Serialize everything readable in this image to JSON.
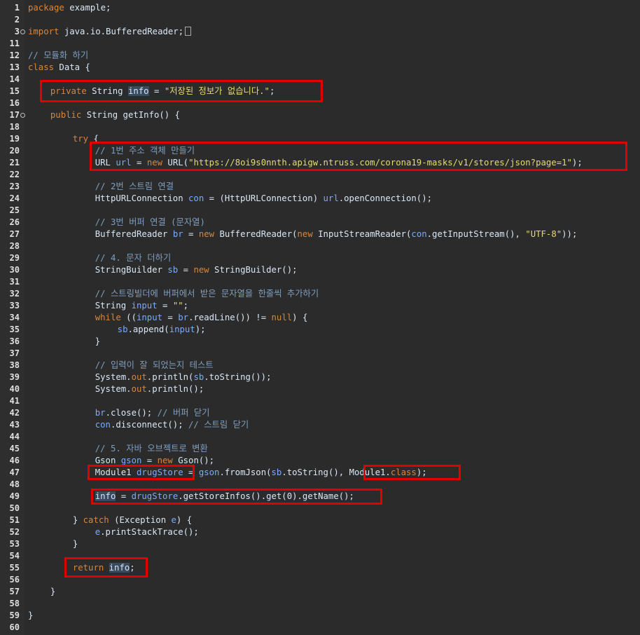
{
  "line_numbers": [
    "1",
    "2",
    "3",
    "11",
    "12",
    "13",
    "14",
    "15",
    "16",
    "17",
    "18",
    "19",
    "20",
    "21",
    "22",
    "23",
    "24",
    "25",
    "26",
    "27",
    "28",
    "29",
    "30",
    "31",
    "32",
    "33",
    "34",
    "35",
    "36",
    "37",
    "38",
    "39",
    "40",
    "41",
    "42",
    "43",
    "44",
    "45",
    "46",
    "47",
    "48",
    "49",
    "50",
    "51",
    "52",
    "53",
    "54",
    "55",
    "56",
    "57",
    "58",
    "59",
    "60"
  ],
  "code": {
    "package": "package example;",
    "import": "import java.io.BufferedReader;",
    "comment_module": "// 모듈화 하기",
    "class_decl": "class Data {",
    "field": "private String info = \"저장된 정보가 없습니다.\";",
    "method": "public String getInfo() {",
    "try": "try {",
    "c1": "// 1번 주소 객체 만들기",
    "url_line": "URL url = new URL(\"https://8oi9s0nnth.apigw.ntruss.com/corona19-masks/v1/stores/json?page=1\");",
    "c2": "// 2번 스트림 연결",
    "conn_line": "HttpURLConnection con = (HttpURLConnection) url.openConnection();",
    "c3": "// 3번 버퍼 연결 (문자열)",
    "br_line": "BufferedReader br = new BufferedReader(new InputStreamReader(con.getInputStream(), \"UTF-8\"));",
    "c4": "// 4. 문자 더하기",
    "sb_line": "StringBuilder sb = new StringBuilder();",
    "c5": "// 스트링빌더에 버퍼에서 받은 문자열을 한줄씩 추가하기",
    "input_line": "String input = \"\";",
    "while_line": "while ((input = br.readLine()) != null) {",
    "append_line": "sb.append(input);",
    "close_brace": "}",
    "c6": "// 입력이 잘 되었는지 테스트",
    "print1": "System.out.println(sb.toString());",
    "print2": "System.out.println();",
    "close1": "br.close(); // 버퍼 닫기",
    "close2": "con.disconnect(); // 스트림 닫기",
    "c7": "// 5. 자바 오브젝트로 변환",
    "gson_line": "Gson gson = new Gson();",
    "module_line": "Module1 drugStore = gson.fromJson(sb.toString(), Module1.class);",
    "info_line": "info = drugStore.getStoreInfos().get(0).getName();",
    "catch_line": "} catch (Exception e) {",
    "trace_line": "e.printStackTrace();",
    "return_line": "return info;"
  },
  "annotation_color": "#e00000"
}
